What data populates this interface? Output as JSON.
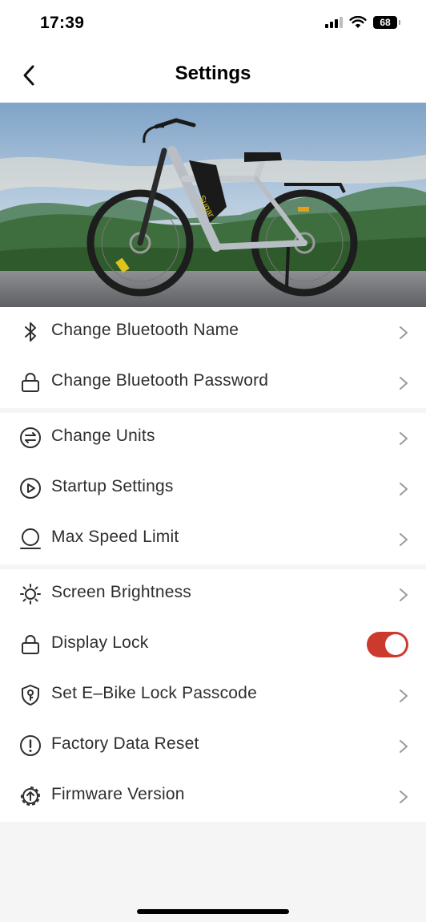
{
  "status_bar": {
    "time": "17:39",
    "battery": "68"
  },
  "header": {
    "title": "Settings",
    "back_icon": "chevron-left-icon"
  },
  "hero": {
    "bike_logo_text": "Sugar"
  },
  "groups": [
    {
      "items": [
        {
          "label": "Change Bluetooth Name",
          "icon": "bluetooth-icon"
        },
        {
          "label": "Change Bluetooth Password",
          "icon": "lock-icon"
        }
      ]
    },
    {
      "items": [
        {
          "label": "Change Units",
          "icon": "units-swap-icon"
        },
        {
          "label": "Startup Settings",
          "icon": "play-circle-icon"
        },
        {
          "label": "Max Speed Limit",
          "icon": "speed-limit-icon"
        }
      ]
    },
    {
      "items": [
        {
          "label": "Screen Brightness",
          "icon": "brightness-icon"
        },
        {
          "label": "Display Lock",
          "icon": "lock-icon",
          "toggle": true,
          "toggle_on": true
        },
        {
          "label": "Set E–Bike Lock Passcode",
          "icon": "key-shield-icon"
        },
        {
          "label": "Factory Data Reset",
          "icon": "alert-circle-icon"
        },
        {
          "label": "Firmware Version",
          "icon": "firmware-upgrade-icon"
        }
      ]
    }
  ],
  "colors": {
    "accent": "#cc3a2e",
    "background": "#f5f5f5",
    "surface": "#ffffff"
  }
}
